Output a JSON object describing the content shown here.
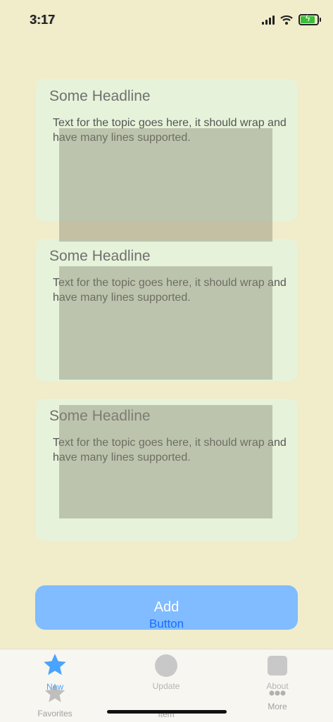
{
  "status_bar": {
    "time": "3:17"
  },
  "cards": [
    {
      "headline": "Some Headline",
      "text": "Text for the topic goes here, it should wrap and have many lines supported."
    },
    {
      "headline": "Some Headline",
      "text": "Text for the topic goes here, it should wrap and have many lines supported."
    },
    {
      "headline": "Some Headline",
      "text": "Text for the topic goes here, it should wrap and have many lines supported."
    }
  ],
  "add_button": {
    "label": "Add",
    "sublabel": "Button"
  },
  "tab_bar": {
    "tabs": [
      {
        "label": "New",
        "icon": "star-icon",
        "active": true
      },
      {
        "label": "Update",
        "icon": "circle-icon"
      },
      {
        "label": "About",
        "icon": "square-icon"
      }
    ],
    "underlying_tabs": [
      {
        "label": "Favorites",
        "icon": "star-icon"
      },
      {
        "label": "Item"
      },
      {
        "label": "More",
        "icon": "more-dots-icon"
      }
    ]
  },
  "colors": {
    "accent": "#4aa3ff",
    "background": "#f1ecc9",
    "card": "#e6f2d9",
    "button": "#80bcff"
  }
}
